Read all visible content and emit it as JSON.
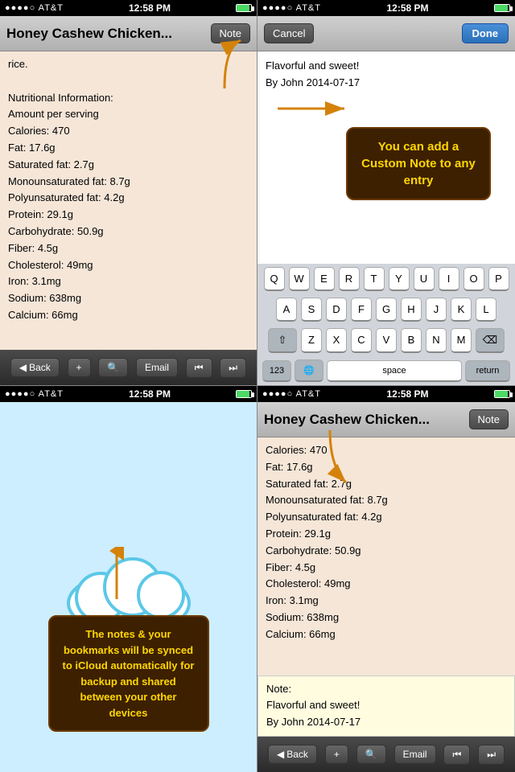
{
  "status": {
    "carrier": "AT&T",
    "time": "12:58 PM",
    "wifi": "wifi"
  },
  "panel_tl": {
    "title": "Honey Cashew Chicken...",
    "note_btn": "Note",
    "content": [
      "rice.",
      "",
      "Nutritional Information:",
      "Amount per serving",
      "Calories: 470",
      "Fat: 17.6g",
      "Saturated fat: 2.7g",
      "Monounsaturated fat: 8.7g",
      "Polyunsaturated fat: 4.2g",
      "Protein: 29.1g",
      "Carbohydrate: 50.9g",
      "Fiber: 4.5g",
      "Cholesterol: 49mg",
      "Iron: 3.1mg",
      "Sodium: 638mg",
      "Calcium: 66mg"
    ],
    "toolbar": {
      "back": "Back",
      "add": "+",
      "search": "🔍",
      "email": "Email",
      "rewind": "⏮",
      "forward": "⏭"
    }
  },
  "panel_tr": {
    "cancel_btn": "Cancel",
    "done_btn": "Done",
    "note_line1": "Flavorful and sweet!",
    "note_line2": "By John 2014-07-17",
    "tooltip": "You can add a Custom Note to any entry",
    "keyboard_rows": [
      [
        "Q",
        "W",
        "E",
        "R",
        "T",
        "Y",
        "U",
        "I",
        "O",
        "P"
      ],
      [
        "A",
        "S",
        "D",
        "F",
        "G",
        "H",
        "J",
        "K",
        "L"
      ],
      [
        "Z",
        "X",
        "C",
        "V",
        "B",
        "N",
        "M"
      ],
      [
        "123",
        "🌐",
        "space",
        "return"
      ]
    ]
  },
  "panel_bl": {
    "tooltip": "The notes & your bookmarks will be synced to iCloud automatically for backup and shared between your other devices"
  },
  "panel_br": {
    "status_carrier": "AT&T",
    "status_time": "12:58 PM",
    "title": "Honey Cashew Chicken...",
    "note_btn": "Note",
    "content": [
      "Calories: 470",
      "Fat: 17.6g",
      "Saturated fat: 2.7g",
      "Monounsaturated fat: 8.7g",
      "Polyunsaturated fat: 4.2g",
      "Protein: 29.1g",
      "Carbohydrate: 50.9g",
      "Fiber: 4.5g",
      "Cholesterol: 49mg",
      "Iron: 3.1mg",
      "Sodium: 638mg",
      "Calcium: 66mg"
    ],
    "note_section_label": "Note:",
    "note_line1": "Flavorful and sweet!",
    "note_line2": "By John 2014-07-17",
    "toolbar": {
      "back": "Back",
      "add": "+",
      "search": "🔍",
      "email": "Email",
      "rewind": "⏮",
      "forward": "⏭"
    }
  }
}
